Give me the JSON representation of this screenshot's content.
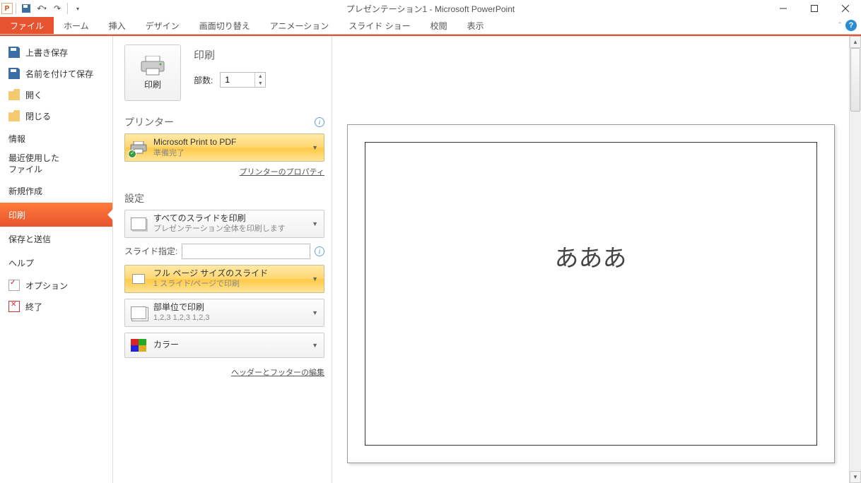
{
  "titlebar": {
    "app_letter": "P",
    "title": "プレゼンテーション1 - Microsoft PowerPoint"
  },
  "ribbon": {
    "file": "ファイル",
    "tabs": [
      "ホーム",
      "挿入",
      "デザイン",
      "画面切り替え",
      "アニメーション",
      "スライド ショー",
      "校閲",
      "表示"
    ]
  },
  "leftnav": {
    "save": "上書き保存",
    "saveas": "名前を付けて保存",
    "open": "開く",
    "close": "閉じる",
    "info": "情報",
    "recent": "最近使用した\nファイル",
    "new": "新規作成",
    "print": "印刷",
    "savesend": "保存と送信",
    "help": "ヘルプ",
    "options": "オプション",
    "exit": "終了"
  },
  "print": {
    "heading": "印刷",
    "button_label": "印刷",
    "copies_label": "部数:",
    "copies_value": "1",
    "printer_heading": "プリンター",
    "printer_name": "Microsoft Print to PDF",
    "printer_status": "準備完了",
    "printer_props": "プリンターのプロパティ",
    "settings_heading": "設定",
    "all_slides_main": "すべてのスライドを印刷",
    "all_slides_sub": "プレゼンテーション全体を印刷します",
    "slide_range_label": "スライド指定:",
    "layout_main": "フル ページ サイズのスライド",
    "layout_sub": "1 スライド/ページで印刷",
    "collate_main": "部単位で印刷",
    "collate_sub": "1,2,3   1,2,3   1,2,3",
    "color_main": "カラー",
    "hf_link": "ヘッダーとフッターの編集"
  },
  "preview": {
    "slide_text": "あああ"
  }
}
